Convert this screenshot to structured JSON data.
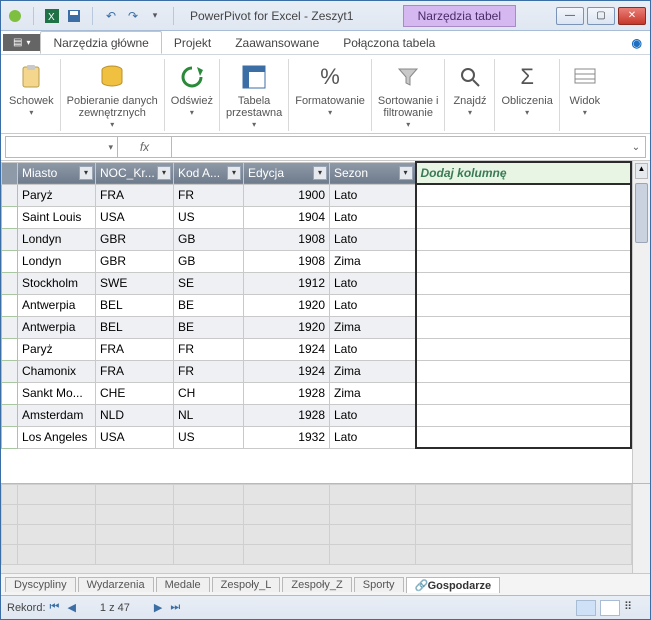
{
  "title": "PowerPivot for Excel - Zeszyt1",
  "context_tab": "Narzędzia tabel",
  "menu": {
    "file": "",
    "home": "Narzędzia główne",
    "projekt": "Projekt",
    "zaaw": "Zaawansowane",
    "linked": "Połączona tabela"
  },
  "ribbon": {
    "schowek": "Schowek",
    "pobieranie": "Pobieranie danych\nzewnętrznych",
    "odswiez": "Odśwież",
    "tabela": "Tabela\nprzestawna",
    "format": "Formatowanie",
    "sort": "Sortowanie i\nfiltrowanie",
    "znajdz": "Znajdź",
    "oblicz": "Obliczenia",
    "widok": "Widok"
  },
  "formula": {
    "name": "",
    "fx": "fx",
    "value": ""
  },
  "columns": [
    "Miasto",
    "NOC_Kr...",
    "Kod A...",
    "Edycja",
    "Sezon"
  ],
  "addcol": "Dodaj kolumnę",
  "rows": [
    {
      "miasto": "Paryż",
      "noc": "FRA",
      "kod": "FR",
      "edycja": 1900,
      "sezon": "Lato"
    },
    {
      "miasto": "Saint Louis",
      "noc": "USA",
      "kod": "US",
      "edycja": 1904,
      "sezon": "Lato"
    },
    {
      "miasto": "Londyn",
      "noc": "GBR",
      "kod": "GB",
      "edycja": 1908,
      "sezon": "Lato"
    },
    {
      "miasto": "Londyn",
      "noc": "GBR",
      "kod": "GB",
      "edycja": 1908,
      "sezon": "Zima"
    },
    {
      "miasto": "Stockholm",
      "noc": "SWE",
      "kod": "SE",
      "edycja": 1912,
      "sezon": "Lato"
    },
    {
      "miasto": "Antwerpia",
      "noc": "BEL",
      "kod": "BE",
      "edycja": 1920,
      "sezon": "Lato"
    },
    {
      "miasto": "Antwerpia",
      "noc": "BEL",
      "kod": "BE",
      "edycja": 1920,
      "sezon": "Zima"
    },
    {
      "miasto": "Paryż",
      "noc": "FRA",
      "kod": "FR",
      "edycja": 1924,
      "sezon": "Lato"
    },
    {
      "miasto": "Chamonix",
      "noc": "FRA",
      "kod": "FR",
      "edycja": 1924,
      "sezon": "Zima"
    },
    {
      "miasto": "Sankt Mo...",
      "noc": "CHE",
      "kod": "CH",
      "edycja": 1928,
      "sezon": "Zima"
    },
    {
      "miasto": "Amsterdam",
      "noc": "NLD",
      "kod": "NL",
      "edycja": 1928,
      "sezon": "Lato"
    },
    {
      "miasto": "Los Angeles",
      "noc": "USA",
      "kod": "US",
      "edycja": 1932,
      "sezon": "Lato"
    }
  ],
  "tabs": [
    "Dyscypliny",
    "Wydarzenia",
    "Medale",
    "Zespoły_L",
    "Zespoły_Z",
    "Sporty",
    "Gospodarze"
  ],
  "active_tab": 6,
  "status": {
    "rekord_label": "Rekord:",
    "position": "1 z 47"
  }
}
